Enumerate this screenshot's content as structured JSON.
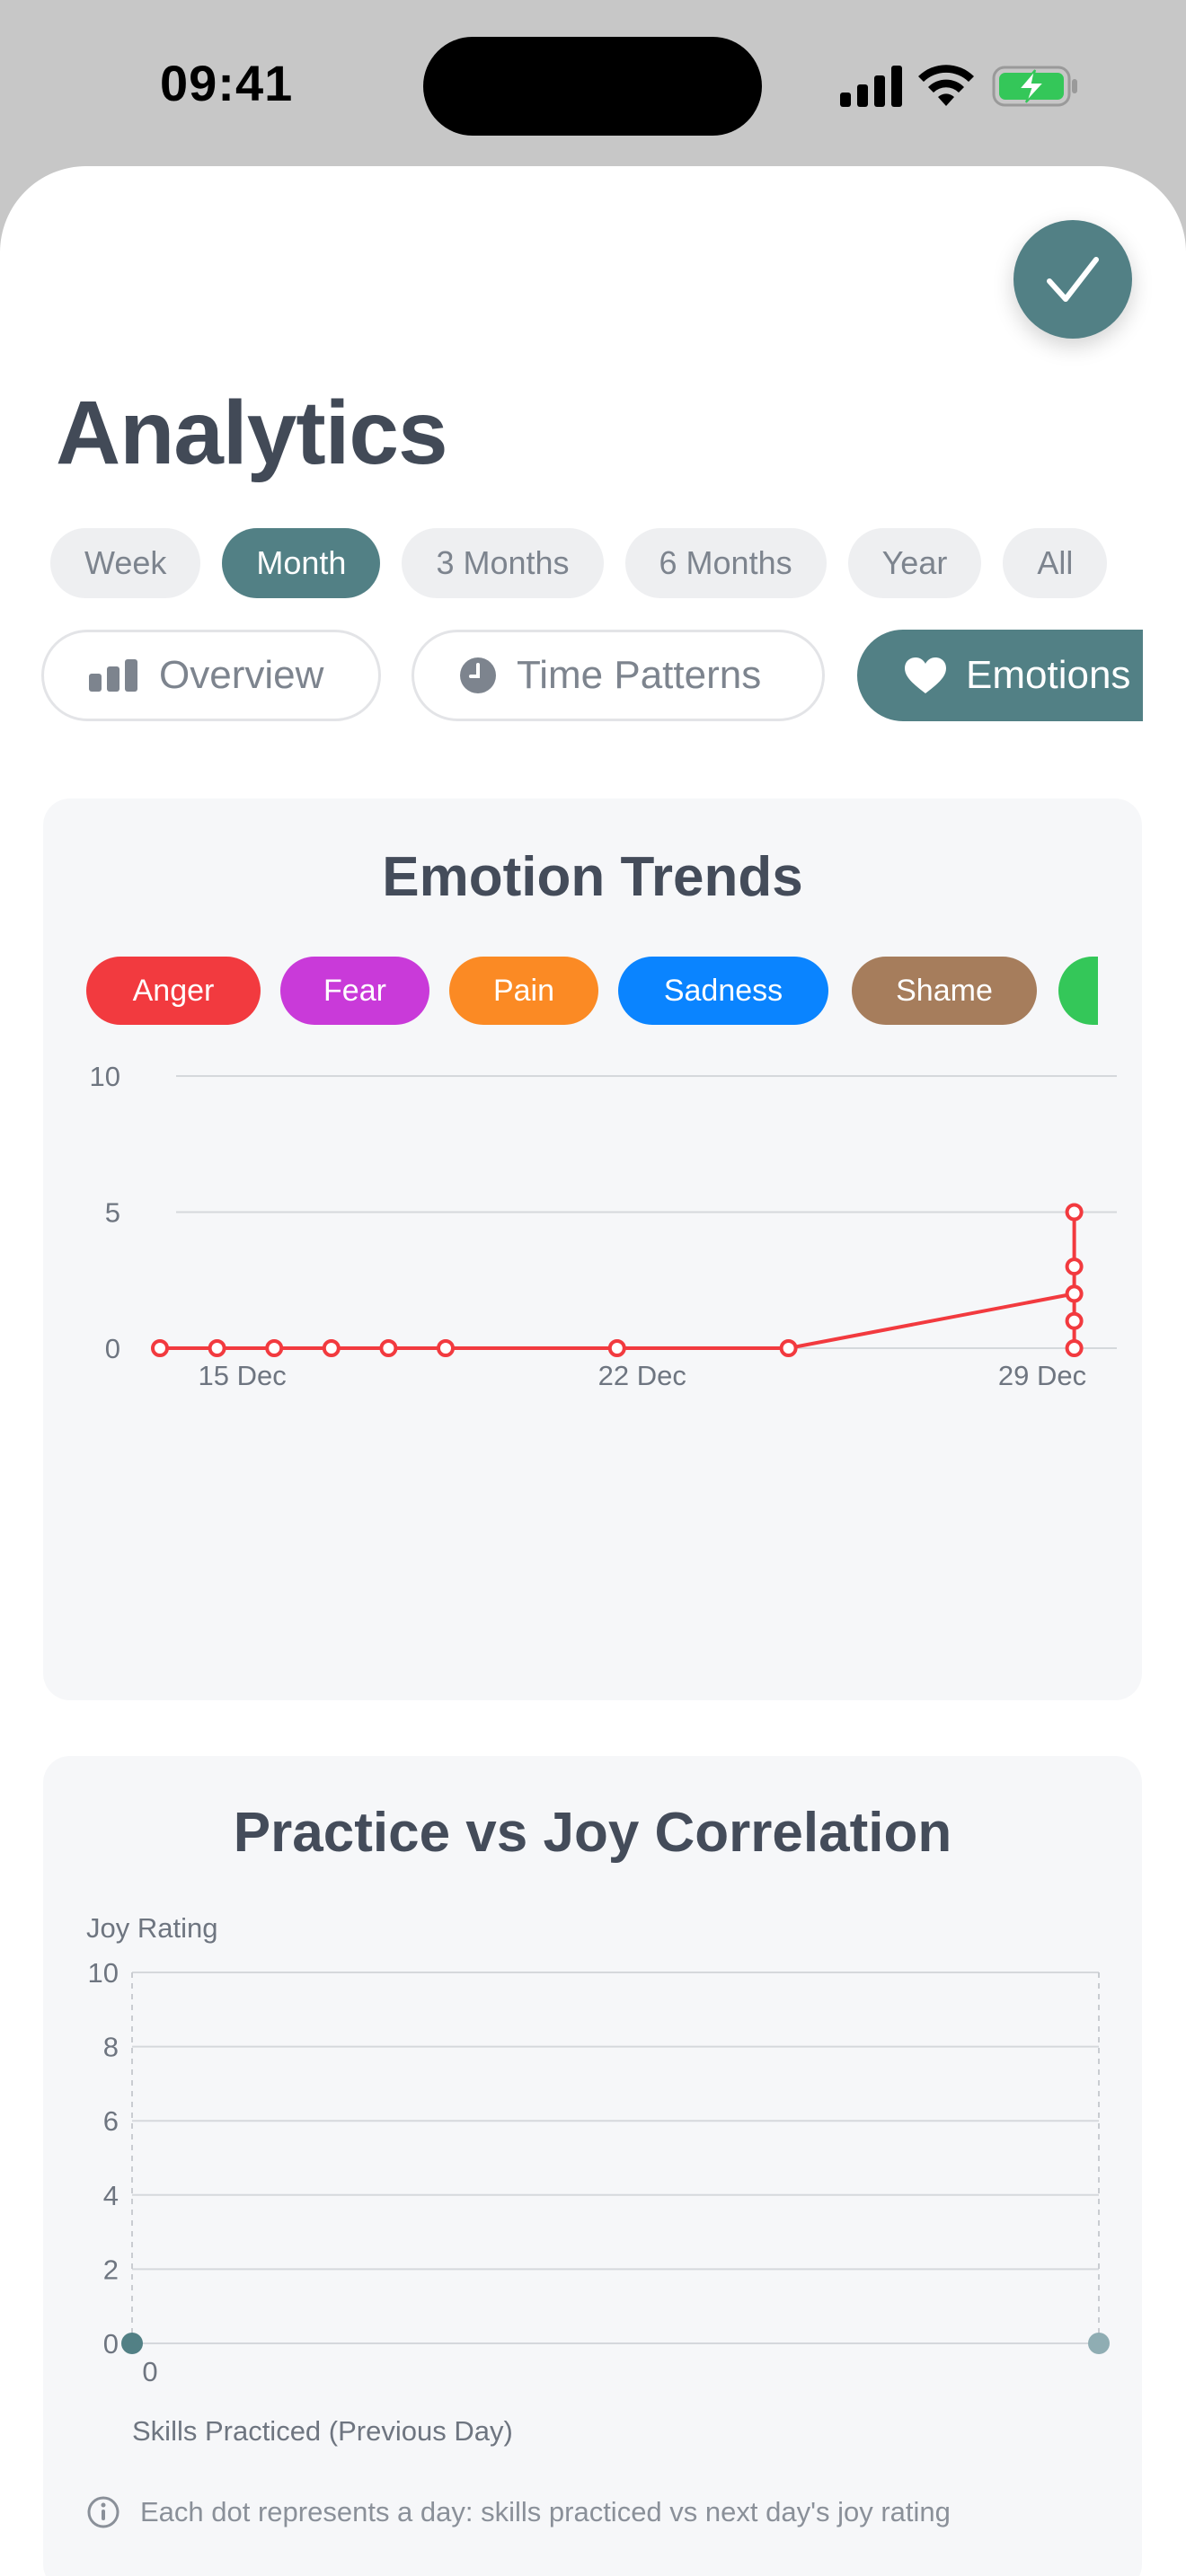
{
  "status_bar": {
    "time": "09:41"
  },
  "header": {
    "title": "Analytics"
  },
  "periods": [
    "Week",
    "Month",
    "3 Months",
    "6 Months",
    "Year",
    "All"
  ],
  "active_period": "Month",
  "tabs": [
    {
      "label": "Overview",
      "icon": "bar-chart-icon"
    },
    {
      "label": "Time Patterns",
      "icon": "clock-icon"
    },
    {
      "label": "Emotions",
      "icon": "heart-icon"
    }
  ],
  "active_tab": "Emotions",
  "emotion_card": {
    "title": "Emotion Trends",
    "chips": [
      {
        "label": "Anger",
        "color": "#f23a3f"
      },
      {
        "label": "Fear",
        "color": "#c93ad9"
      },
      {
        "label": "Pain",
        "color": "#fb8a24"
      },
      {
        "label": "Sadness",
        "color": "#0a84ff"
      },
      {
        "label": "Shame",
        "color": "#a67d5c"
      },
      {
        "label": "",
        "color": "#34c759"
      }
    ]
  },
  "correlation_card": {
    "title": "Practice vs Joy Correlation",
    "info": "Each dot represents a day: skills practiced vs next day's joy rating"
  },
  "chart_data": [
    {
      "type": "line",
      "title": "Emotion Trends",
      "x_tick_labels": [
        "15 Dec",
        "22 Dec",
        "29 Dec"
      ],
      "ylim": [
        0,
        10
      ],
      "y_ticks": [
        0,
        5,
        10
      ],
      "grid": true,
      "series": [
        {
          "name": "Anger",
          "color": "#f23a3f",
          "x": [
            "14 Dec",
            "15 Dec",
            "16 Dec",
            "17 Dec",
            "18 Dec",
            "19 Dec",
            "22 Dec",
            "25 Dec",
            "30 Dec"
          ],
          "y": [
            0,
            0,
            0,
            0,
            0,
            0,
            0,
            0,
            2
          ]
        }
      ],
      "extra_points_30_Dec": [
        5,
        3,
        1,
        0
      ]
    },
    {
      "type": "scatter",
      "title": "Practice vs Joy Correlation",
      "xlabel": "Skills Practiced (Previous Day)",
      "ylabel": "Joy Rating",
      "x_tick_labels": [
        "0"
      ],
      "y_ticks": [
        0,
        2,
        4,
        6,
        8,
        10
      ],
      "ylim": [
        0,
        10
      ],
      "grid": true,
      "points": [
        {
          "x": 0,
          "y": 0,
          "color": "#528085"
        },
        {
          "x": 1,
          "y": 0,
          "color": "#8fadb3"
        }
      ]
    }
  ]
}
